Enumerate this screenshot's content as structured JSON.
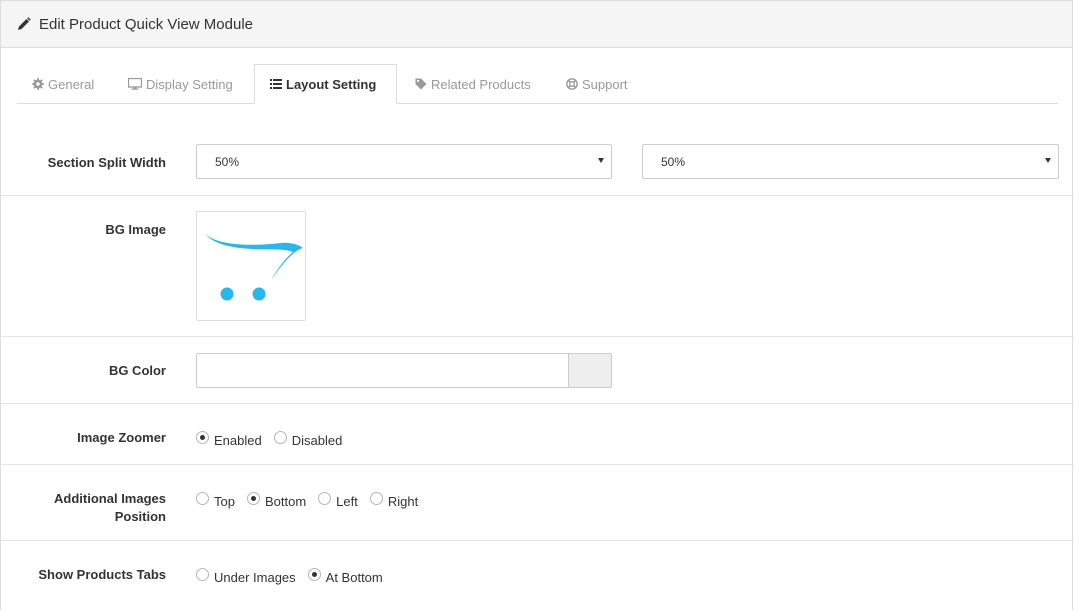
{
  "header": {
    "title": "Edit Product Quick View Module",
    "icon": "pencil-icon"
  },
  "tabs": [
    {
      "label": "General",
      "icon": "gear-icon",
      "active": false
    },
    {
      "label": "Display Setting",
      "icon": "monitor-icon",
      "active": false
    },
    {
      "label": "Layout Setting",
      "icon": "list-icon",
      "active": true
    },
    {
      "label": "Related Products",
      "icon": "tag-icon",
      "active": false
    },
    {
      "label": "Support",
      "icon": "lifebuoy-icon",
      "active": false
    }
  ],
  "form": {
    "section_split": {
      "label": "Section Split Width",
      "left_value": "50%",
      "right_value": "50%"
    },
    "bg_image": {
      "label": "BG Image",
      "accent": "#29b6e8"
    },
    "bg_color": {
      "label": "BG Color",
      "value": ""
    },
    "image_zoomer": {
      "label": "Image Zoomer",
      "options": [
        {
          "label": "Enabled",
          "checked": true
        },
        {
          "label": "Disabled",
          "checked": false
        }
      ]
    },
    "additional_images": {
      "label_line1": "Additional Images",
      "label_line2": "Position",
      "options": [
        {
          "label": "Top",
          "checked": false
        },
        {
          "label": "Bottom",
          "checked": true
        },
        {
          "label": "Left",
          "checked": false
        },
        {
          "label": "Right",
          "checked": false
        }
      ]
    },
    "products_tabs": {
      "label": "Show Products Tabs",
      "options": [
        {
          "label": "Under Images",
          "checked": false
        },
        {
          "label": "At Bottom",
          "checked": true
        }
      ]
    }
  }
}
